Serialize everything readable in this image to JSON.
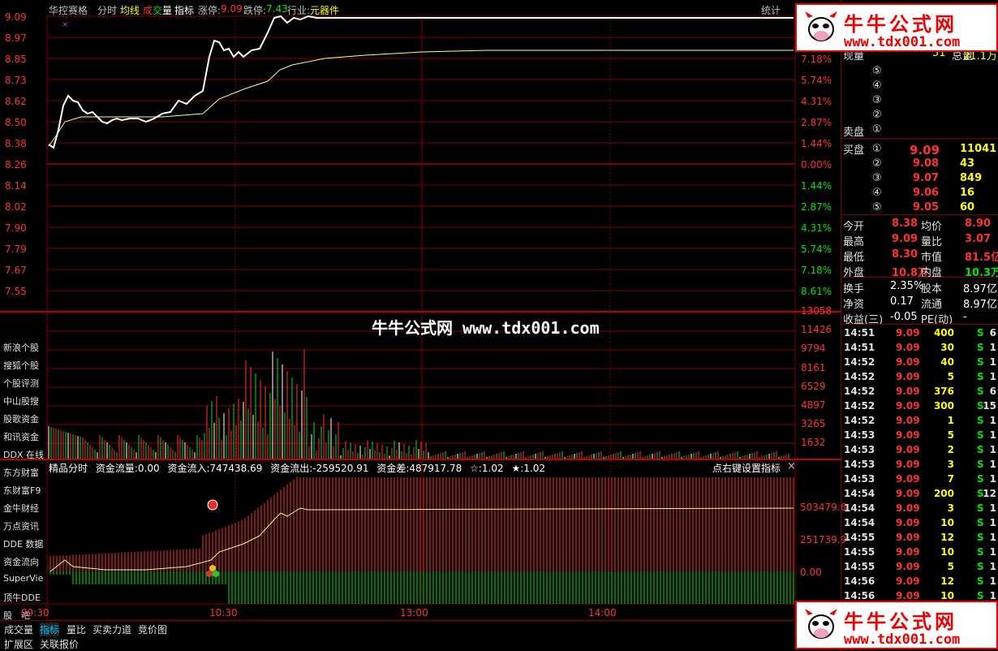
{
  "header": {
    "stock_name": "华控赛格",
    "tabs": [
      {
        "label": "分时",
        "color": "#c0c0c0"
      },
      {
        "label": "均线",
        "color": "#ffff00"
      },
      {
        "label_a": "成",
        "label_b": "交",
        "label_c": "量"
      },
      {
        "label": "指标",
        "color": "#ffffff"
      }
    ],
    "limit_up_label": "涨停:",
    "limit_up_value": "9.09",
    "limit_down_label": "跌停:",
    "limit_down_value": "7.43",
    "industry_label": "行业:",
    "industry_value": "元器件",
    "stats_button": "统计"
  },
  "price_axis_left": [
    "9.09",
    "8.97",
    "8.85",
    "8.73",
    "8.62",
    "8.50",
    "8.38",
    "8.26",
    "8.14",
    "8.02",
    "7.90",
    "7.79",
    "7.67",
    "7.55"
  ],
  "pct_axis_right": [
    "7.18%",
    "5.74%",
    "4.31%",
    "2.87%",
    "1.44%",
    "0.00%",
    "1.44%",
    "2.87%",
    "4.31%",
    "5.74%",
    "7.18%",
    "8.61%"
  ],
  "volume_axis": [
    "13058",
    "11426",
    "9794",
    "8161",
    "6529",
    "4897",
    "3265",
    "1632"
  ],
  "left_menu": [
    "新浪个股",
    "搜狐个股",
    "个股评测",
    "中山股搜",
    "股歌资金",
    "和讯资金",
    "DDX 在线",
    "东方财富",
    "东财富F9",
    "金牛财经",
    "万点资讯",
    "DDE 数据",
    "资金流向",
    "SuperVie",
    "顶牛DDE",
    "股　吧"
  ],
  "indicator": {
    "title": "精品分时",
    "flow_label": "资金流量:",
    "flow_value": "0.00",
    "in_label": "资金流入:",
    "in_value": "747438.69",
    "out_label": "资金流出:",
    "out_value": "-259520.91",
    "diff_label": "资金差:",
    "diff_value": "487917.78",
    "star1": "☆:1.02",
    "star2": "★:1.02",
    "settings": "点右键设置指标",
    "close": "×",
    "axis": [
      "503479.6",
      "251739.9",
      "0.00"
    ]
  },
  "time_axis": [
    "09:30",
    "10:30",
    "13:00",
    "14:00"
  ],
  "watermark": {
    "center": "牛牛公式网 www.tdx001.com",
    "logo_cn": "牛牛公式网",
    "logo_url": "www.tdx001.com"
  },
  "quote": {
    "xianliang_label": "现量",
    "xianliang_value": "51",
    "zongliang_label": "总量",
    "zongliang_value": "21.1万",
    "sell_label": "卖盘",
    "sell_levels": [
      "⑤",
      "④",
      "③",
      "②",
      "①"
    ],
    "buy_label": "买盘",
    "buy_levels": [
      {
        "n": "①",
        "price": "9.09",
        "vol": "11041"
      },
      {
        "n": "②",
        "price": "9.08",
        "vol": "43"
      },
      {
        "n": "③",
        "price": "9.07",
        "vol": "849"
      },
      {
        "n": "④",
        "price": "9.06",
        "vol": "16"
      },
      {
        "n": "⑤",
        "price": "9.05",
        "vol": "60"
      }
    ],
    "stats": [
      {
        "l1": "今开",
        "v1": "8.38",
        "l2": "均价",
        "v2": "8.90"
      },
      {
        "l1": "最高",
        "v1": "9.09",
        "l2": "量比",
        "v2": "3.07"
      },
      {
        "l1": "最低",
        "v1": "8.30",
        "l2": "市值",
        "v2": "81.5亿"
      },
      {
        "l1": "外盘",
        "v1": "10.8万",
        "l2": "内盘",
        "v2": "10.3万"
      }
    ],
    "stats2": [
      {
        "l1": "换手",
        "v1": "2.35%",
        "l2": "股本",
        "v2": "8.97亿"
      },
      {
        "l1": "净资",
        "v1": "0.17",
        "l2": "流通",
        "v2": "8.97亿"
      },
      {
        "l1": "收益(三)",
        "v1": "-0.05",
        "l2": "PE(动)",
        "v2": "-"
      }
    ]
  },
  "ticks": [
    {
      "t": "14:51",
      "p": "9.09",
      "v": "400",
      "s": "S",
      "n": "6"
    },
    {
      "t": "14:51",
      "p": "9.09",
      "v": "30",
      "s": "S",
      "n": "1"
    },
    {
      "t": "14:52",
      "p": "9.09",
      "v": "40",
      "s": "S",
      "n": "1"
    },
    {
      "t": "14:52",
      "p": "9.09",
      "v": "5",
      "s": "S",
      "n": "1"
    },
    {
      "t": "14:52",
      "p": "9.09",
      "v": "376",
      "s": "S",
      "n": "6"
    },
    {
      "t": "14:52",
      "p": "9.09",
      "v": "300",
      "s": "S",
      "n": "15"
    },
    {
      "t": "14:52",
      "p": "9.09",
      "v": "1",
      "s": "S",
      "n": "1"
    },
    {
      "t": "14:53",
      "p": "9.09",
      "v": "5",
      "s": "S",
      "n": "1"
    },
    {
      "t": "14:53",
      "p": "9.09",
      "v": "2",
      "s": "S",
      "n": "1"
    },
    {
      "t": "14:53",
      "p": "9.09",
      "v": "3",
      "s": "S",
      "n": "1"
    },
    {
      "t": "14:53",
      "p": "9.09",
      "v": "7",
      "s": "S",
      "n": "1"
    },
    {
      "t": "14:54",
      "p": "9.09",
      "v": "200",
      "s": "S",
      "n": "12"
    },
    {
      "t": "14:54",
      "p": "9.09",
      "v": "3",
      "s": "S",
      "n": "1"
    },
    {
      "t": "14:54",
      "p": "9.09",
      "v": "10",
      "s": "S",
      "n": "1"
    },
    {
      "t": "14:55",
      "p": "9.09",
      "v": "12",
      "s": "S",
      "n": "1"
    },
    {
      "t": "14:55",
      "p": "9.09",
      "v": "10",
      "s": "S",
      "n": "1"
    },
    {
      "t": "14:55",
      "p": "9.09",
      "v": "5",
      "s": "S",
      "n": "1"
    },
    {
      "t": "14:56",
      "p": "9.09",
      "v": "12",
      "s": "S",
      "n": "1"
    },
    {
      "t": "14:56",
      "p": "9.09",
      "v": "10",
      "s": "S",
      "n": "1"
    }
  ],
  "bottom_tabs": [
    "成交量",
    "指标",
    "量比",
    "买卖力道",
    "竞价图"
  ],
  "bottom_tabs2": [
    "扩展区",
    "关联报价"
  ],
  "colors": {
    "grid": "#800000",
    "up": "#ff3232",
    "down": "#00e600",
    "avg": "#ffff80"
  }
}
